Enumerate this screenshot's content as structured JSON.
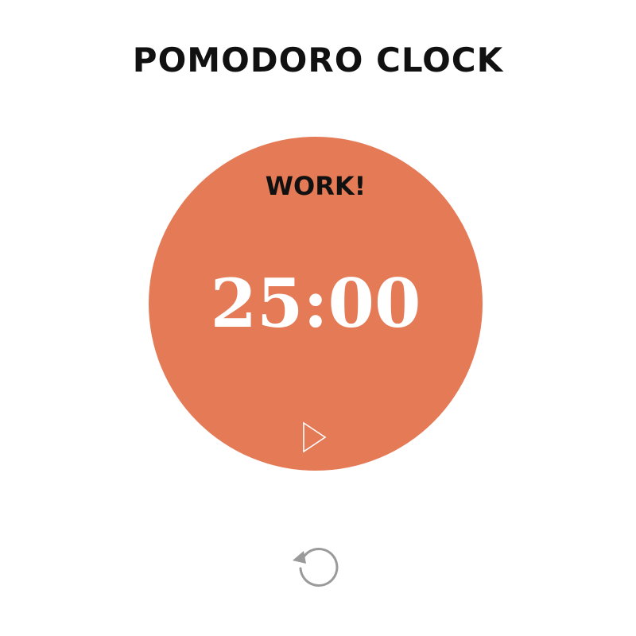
{
  "app": {
    "title": "POMODORO CLOCK"
  },
  "timer": {
    "mode_label": "WORK!",
    "time": "25:00",
    "circle_color": "#e57a56",
    "time_color": "#ffffff"
  },
  "controls": {
    "play_icon": "play-icon",
    "reset_icon": "reset-icon",
    "reset_icon_color": "#9a9a9a"
  }
}
